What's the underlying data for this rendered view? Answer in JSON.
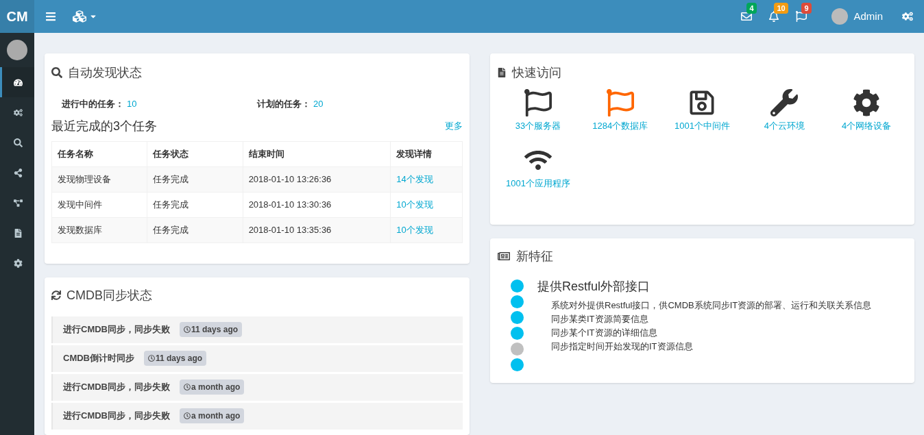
{
  "brand": "CM",
  "topbar": {
    "notifications": [
      {
        "kind": "mail",
        "count": "4",
        "color": "#00a65a"
      },
      {
        "kind": "bell",
        "count": "10",
        "color": "#f39c12"
      },
      {
        "kind": "flag",
        "count": "9",
        "color": "#dd4b39"
      }
    ],
    "user": "Admin"
  },
  "sidebar": {
    "items": [
      {
        "kind": "dashboard",
        "selected": true
      },
      {
        "kind": "cogs",
        "selected": false
      },
      {
        "kind": "search",
        "selected": false
      },
      {
        "kind": "share",
        "selected": false
      },
      {
        "kind": "diagram",
        "selected": false
      },
      {
        "kind": "file",
        "selected": false
      },
      {
        "kind": "gear",
        "selected": false
      }
    ]
  },
  "discovery": {
    "title": "自动发现状态",
    "stats": [
      {
        "label": "进行中的任务：",
        "value": "10"
      },
      {
        "label": "计划的任务：",
        "value": "20"
      }
    ],
    "subtitle": "最近完成的3个任务",
    "more": "更多",
    "table": {
      "columns": [
        "任务名称",
        "任务状态",
        "结束时间",
        "发现详情"
      ],
      "rows": [
        [
          "发现物理设备",
          "任务完成",
          "2018-01-10 13:26:36",
          "14个发现"
        ],
        [
          "发现中间件",
          "任务完成",
          "2018-01-10 13:30:36",
          "10个发现"
        ],
        [
          "发现数据库",
          "任务完成",
          "2018-01-10 13:35:36",
          "10个发现"
        ]
      ]
    }
  },
  "sync": {
    "title": "CMDB同步状态",
    "items": [
      {
        "text": "进行CMDB同步，同步失败",
        "time": "11 days ago"
      },
      {
        "text": "CMDB倒计时同步",
        "time": "11 days ago"
      },
      {
        "text": "进行CMDB同步，同步失败",
        "time": "a month ago"
      },
      {
        "text": "进行CMDB同步，同步失败",
        "time": "a month ago"
      }
    ]
  },
  "quick": {
    "title": "快速访问",
    "items": [
      {
        "kind": "flag",
        "label": "33个服务器",
        "color": "#333333"
      },
      {
        "kind": "flag",
        "label": "1284个数据库",
        "color": "#ff6600"
      },
      {
        "kind": "save",
        "label": "1001个中间件",
        "color": "#333333"
      },
      {
        "kind": "wrench",
        "label": "4个云环境",
        "color": "#333333"
      },
      {
        "kind": "gear",
        "label": "4个网络设备",
        "color": "#333333"
      },
      {
        "kind": "wifi",
        "label": "1001个应用程序",
        "color": "#333333"
      }
    ]
  },
  "features": {
    "title": "新特征",
    "heading": "提供Restful外部接口",
    "lines": [
      "系统对外提供Restful接口，供CMDB系统同步IT资源的部署、运行和关联关系信息",
      "同步某类IT资源简要信息",
      "同步某个IT资源的详细信息",
      "同步指定时间开始发现的IT资源信息"
    ],
    "dots": [
      {
        "color": "#00c0ef"
      },
      {
        "color": "#00c0ef"
      },
      {
        "color": "#00c0ef"
      },
      {
        "color": "#00c0ef"
      },
      {
        "color": "#c0c0c0"
      },
      {
        "color": "#00c0ef"
      }
    ]
  }
}
